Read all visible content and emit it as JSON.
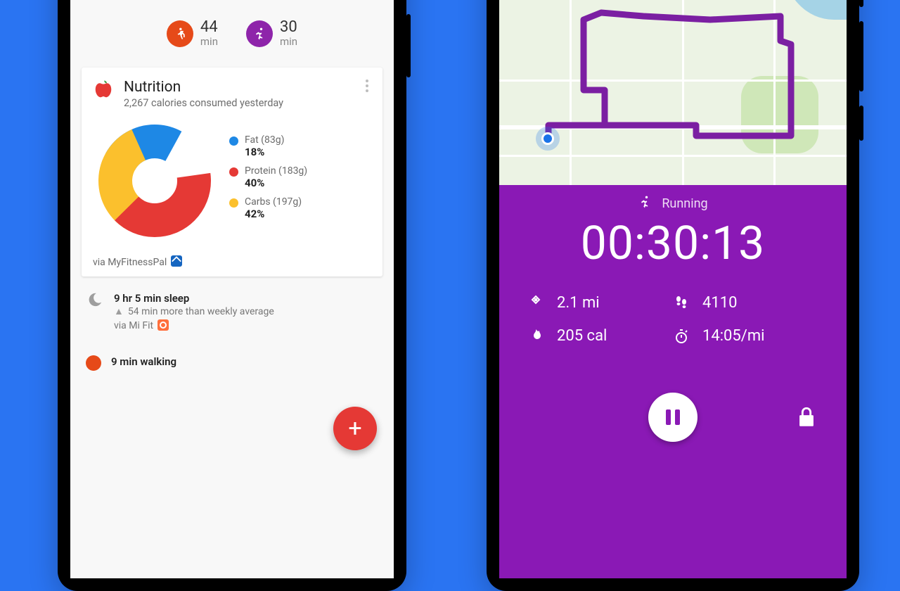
{
  "left": {
    "summary": [
      {
        "id": "walking",
        "value": "44",
        "unit": "min",
        "color": "#e64a19"
      },
      {
        "id": "running",
        "value": "30",
        "unit": "min",
        "color": "#8e24aa"
      }
    ],
    "nutrition": {
      "title": "Nutrition",
      "subtitle": "2,267 calories consumed yesterday",
      "via": "via MyFitnessPal",
      "legend": [
        {
          "label": "Fat (83g)",
          "value": "18%",
          "color": "#1e88e5"
        },
        {
          "label": "Protein (183g)",
          "value": "40%",
          "color": "#e53935"
        },
        {
          "label": "Carbs (197g)",
          "value": "42%",
          "color": "#fbc02d"
        }
      ]
    },
    "timeline": {
      "sleep": {
        "title": "9 hr 5 min sleep",
        "delta": "54 min more than weekly average",
        "via": "via Mi Fit"
      },
      "walking": {
        "title": "9 min walking"
      }
    },
    "fab": "+"
  },
  "right": {
    "activity": "Running",
    "timer": "00:30:13",
    "stats": {
      "distance": "2.1 mi",
      "steps": "4110",
      "calories": "205 cal",
      "pace": "14:05/mi"
    }
  },
  "chart_data": {
    "type": "pie",
    "title": "Nutrition",
    "series": [
      {
        "name": "Fat",
        "grams": 83,
        "percent": 18,
        "color": "#1e88e5"
      },
      {
        "name": "Protein",
        "grams": 183,
        "percent": 40,
        "color": "#e53935"
      },
      {
        "name": "Carbs",
        "grams": 197,
        "percent": 42,
        "color": "#fbc02d"
      }
    ],
    "total_calories": 2267
  }
}
